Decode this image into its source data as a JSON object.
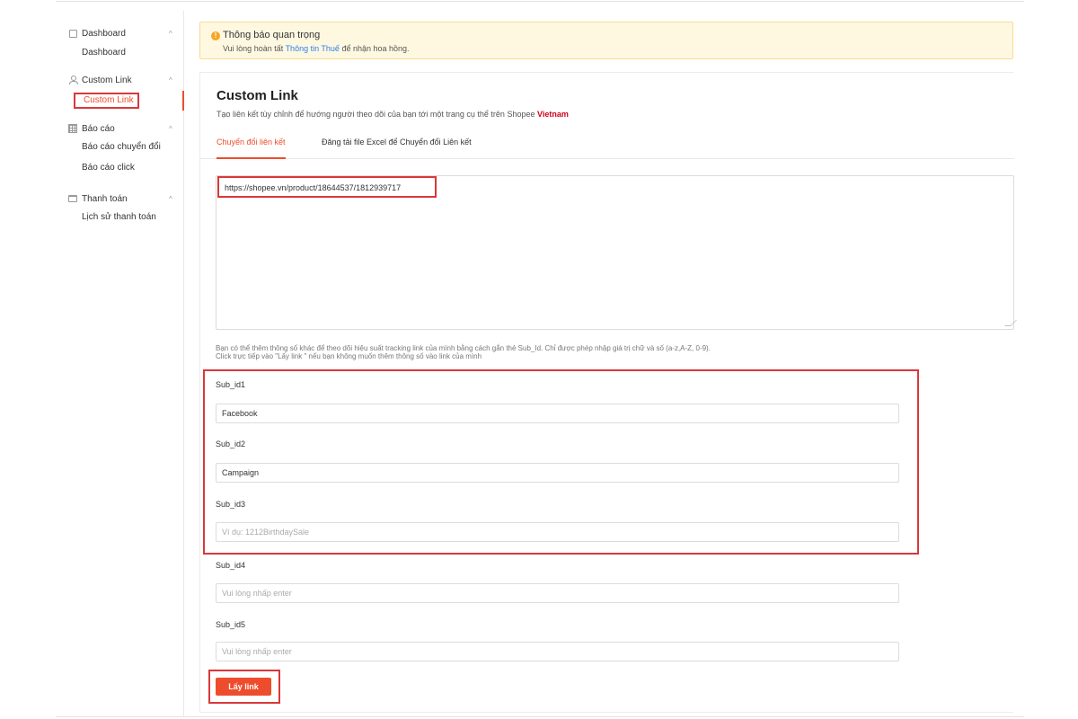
{
  "sidebar": {
    "groups": [
      {
        "label": "Dashboard",
        "icon": "dashboard-icon",
        "items": [
          "Dashboard"
        ]
      },
      {
        "label": "Custom Link",
        "icon": "user-icon",
        "items": [
          "Custom Link"
        ]
      },
      {
        "label": "Báo cáo",
        "icon": "calendar-icon",
        "items": [
          "Báo cáo chuyển đổi",
          "Báo cáo click"
        ]
      },
      {
        "label": "Thanh toán",
        "icon": "card-icon",
        "items": [
          "Lịch sử thanh toán"
        ]
      }
    ],
    "active_item": "Custom Link"
  },
  "notice": {
    "title": "Thông báo quan trọng",
    "desc_prefix": "Vui lòng hoàn tất ",
    "desc_link": "Thông tin Thuế",
    "desc_suffix": " để nhận hoa hồng."
  },
  "panel": {
    "title": "Custom Link",
    "subtitle_prefix": "Tạo liên kết tùy chỉnh để hướng người theo dõi của bạn tới một trang cụ thể trên Shopee ",
    "subtitle_brand": "Vietnam",
    "tabs": [
      "Chuyển đổi liên kết",
      "Đăng tải file Excel để Chuyển đổi Liên kết"
    ],
    "url_value": "https://shopee.vn/product/18644537/1812939717",
    "hint_line1": "Bạn có thể thêm thông số khác để theo dõi hiệu suất tracking link của mình bằng cách gắn thẻ Sub_Id. Chỉ được phép nhập giá trị chữ và số (a-z,A-Z, 0-9).",
    "hint_line2": "Click trực tiếp vào \"Lấy link \" nếu bạn không muốn thêm thông số vào link của mình",
    "subs": [
      {
        "label": "Sub_id1",
        "value": "Facebook",
        "placeholder": ""
      },
      {
        "label": "Sub_id2",
        "value": "Campaign",
        "placeholder": ""
      },
      {
        "label": "Sub_id3",
        "value": "",
        "placeholder": "Ví dụ: 1212BirthdaySale"
      },
      {
        "label": "Sub_id4",
        "value": "",
        "placeholder": "Vui lòng nhấp enter"
      },
      {
        "label": "Sub_id5",
        "value": "",
        "placeholder": "Vui lòng nhấp enter"
      }
    ],
    "button_label": "Lấy link"
  },
  "colors": {
    "accent": "#ee4d2d",
    "highlight": "#d9383a",
    "link": "#2f80ed",
    "notice_bg": "#fff8e1"
  }
}
